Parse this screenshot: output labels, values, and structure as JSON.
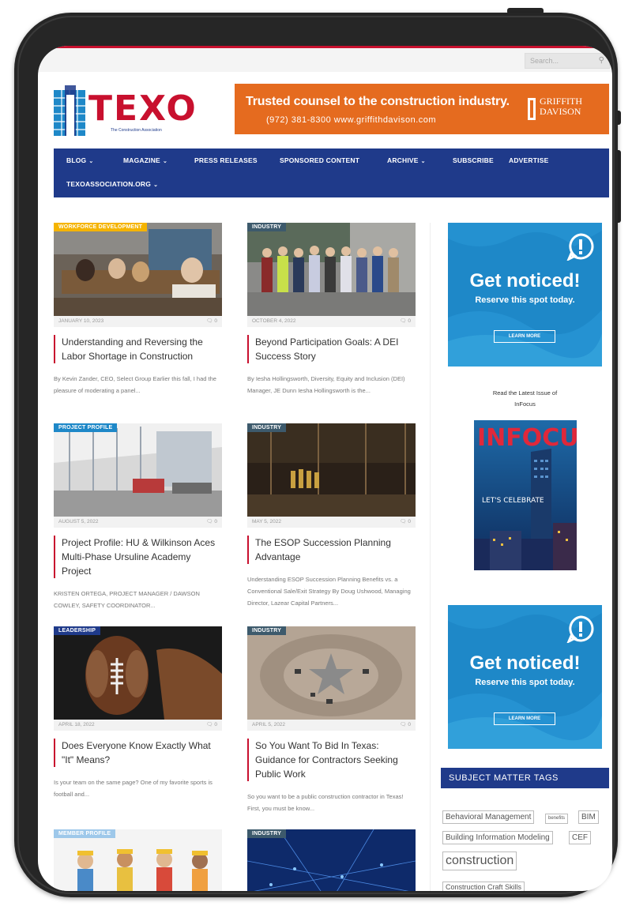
{
  "site": {
    "search_placeholder": "Search...",
    "logo_text": "TEXO",
    "logo_tagline": "The Construction Association"
  },
  "banner": {
    "headline": "Trusted counsel to the construction industry.",
    "contact": "(972) 381-8300    www.griffithdavison.com",
    "brand_line1": "GRIFFITH",
    "brand_line2": "DAVISON"
  },
  "nav": {
    "items": [
      {
        "label": "BLOG",
        "dropdown": true
      },
      {
        "label": "MAGAZINE",
        "dropdown": true
      },
      {
        "label": "PRESS RELEASES",
        "dropdown": false
      },
      {
        "label": "SPONSORED CONTENT",
        "dropdown": false
      },
      {
        "label": "ARCHIVE",
        "dropdown": true
      },
      {
        "label": "SUBSCRIBE",
        "dropdown": false
      },
      {
        "label": "ADVERTISE",
        "dropdown": false
      },
      {
        "label": "TEXOASSOCIATION.ORG",
        "dropdown": true
      }
    ]
  },
  "articles": [
    {
      "category": "WORKFORCE DEVELOPMENT",
      "category_color": "#f5b400",
      "date": "JANUARY 10, 2023",
      "comments": "0",
      "title": "Understanding and Reversing the Labor Shortage in Construction",
      "excerpt": "By Kevin Zander, CEO, Select Group Earlier this fall, I had the pleasure of moderating a panel..."
    },
    {
      "category": "INDUSTRY",
      "category_color": "#3d5a6c",
      "date": "OCTOBER 4, 2022",
      "comments": "0",
      "title": "Beyond Participation Goals: A DEI Success Story",
      "excerpt": "By Iesha Hollingsworth, Diversity, Equity and Inclusion (DEI) Manager, JE Dunn Iesha Hollingsworth is the..."
    },
    {
      "category": "PROJECT PROFILE",
      "category_color": "#1e88c8",
      "date": "AUGUST 5, 2022",
      "comments": "0",
      "title": "Project Profile: HU & Wilkinson Aces Multi-Phase Ursuline Academy Project",
      "excerpt": "KRISTEN ORTEGA, PROJECT MANAGER / DAWSON COWLEY, SAFETY COORDINATOR..."
    },
    {
      "category": "INDUSTRY",
      "category_color": "#3d5a6c",
      "date": "MAY 5, 2022",
      "comments": "0",
      "title": "The ESOP Succession Planning Advantage",
      "excerpt": "Understanding ESOP Succession Planning Benefits vs. a Conventional Sale/Exit Strategy By Doug Ushwood, Managing Director, Lazear Capital Partners..."
    },
    {
      "category": "LEADERSHIP",
      "category_color": "#1f3a8a",
      "date": "APRIL 18, 2022",
      "comments": "0",
      "title": "Does Everyone Know Exactly What \"It\" Means?",
      "excerpt": "Is your team on the same page? One of my favorite sports is football and..."
    },
    {
      "category": "INDUSTRY",
      "category_color": "#3d5a6c",
      "date": "APRIL 5, 2022",
      "comments": "0",
      "title": "So You Want To Bid In Texas: Guidance for Contractors Seeking Public Work",
      "excerpt": "So you want to be a public construction contractor in Texas! First, you must be know..."
    },
    {
      "category": "MEMBER PROFILE",
      "category_color": "#9ec8ea",
      "date": "",
      "comments": "",
      "title": "",
      "excerpt": ""
    },
    {
      "category": "INDUSTRY",
      "category_color": "#3d5a6c",
      "date": "",
      "comments": "",
      "title": "",
      "excerpt": ""
    }
  ],
  "sidebar": {
    "ad_title": "Get noticed!",
    "ad_sub": "Reserve this spot today.",
    "ad_button": "LEARN MORE",
    "issue_label_line1": "Read the Latest Issue of",
    "issue_label_line2": "InFocus",
    "magazine_title": "INFOCUS",
    "magazine_headline": "LET'S CELEBRATE",
    "tags_heading": "SUBJECT MATTER TAGS",
    "tags": [
      "Behavioral Management",
      "benefits",
      "BIM",
      "Building Information Modeling",
      "CEF",
      "construction",
      "Construction Craft Skills"
    ]
  },
  "colors": {
    "brand_red": "#c8102e",
    "nav_blue": "#1f3a8a",
    "banner_orange": "#e56b1f",
    "ad_blue": "#1e88c8"
  }
}
